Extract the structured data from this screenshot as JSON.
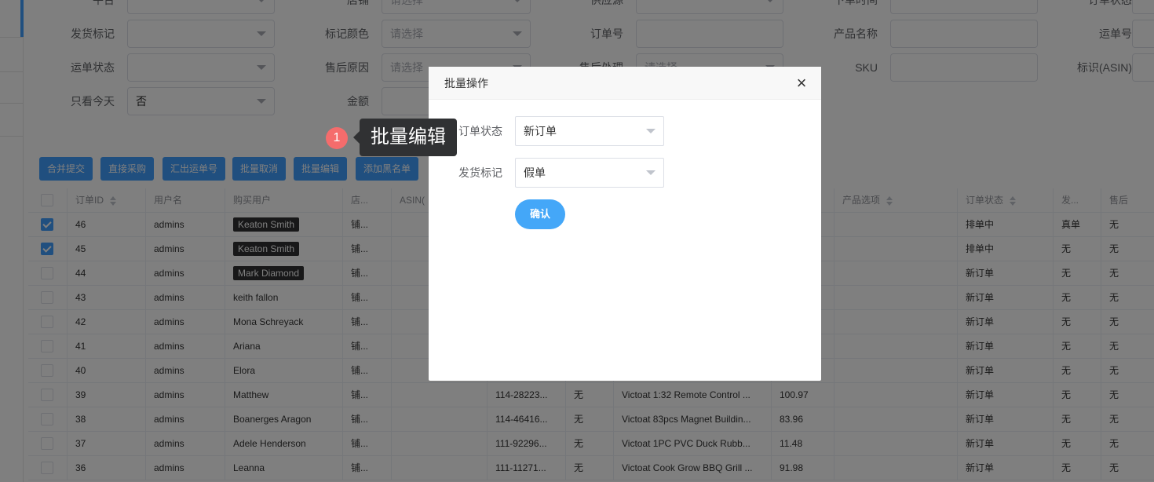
{
  "filters": {
    "row0": [
      {
        "label": "平台",
        "placeholder": ""
      },
      {
        "label": "店铺",
        "placeholder": "请选择"
      },
      {
        "label": "供应源",
        "placeholder": ""
      },
      {
        "label": "下单时间",
        "placeholder": ""
      },
      {
        "label": "订单状态",
        "placeholder": ""
      }
    ],
    "row1": [
      {
        "label": "发货标记",
        "placeholder": ""
      },
      {
        "label": "标记颜色",
        "placeholder": "请选择"
      },
      {
        "label": "订单号",
        "placeholder": ""
      },
      {
        "label": "产品名称",
        "placeholder": ""
      },
      {
        "label": "运单号",
        "placeholder": ""
      }
    ],
    "row2": [
      {
        "label": "运单状态",
        "placeholder": ""
      },
      {
        "label": "售后原因",
        "placeholder": "请选择"
      },
      {
        "label": "售后处理",
        "placeholder": "请选择"
      },
      {
        "label": "SKU",
        "placeholder": ""
      },
      {
        "label": "标识(ASIN)",
        "placeholder": ""
      }
    ],
    "row3": [
      {
        "label": "只看今天",
        "value": "否"
      },
      {
        "label": "金额",
        "placeholder": ""
      }
    ]
  },
  "hint": {
    "number": "1",
    "text": "批量编辑"
  },
  "toolbar": {
    "buttons": [
      "合并提交",
      "直接采购",
      "汇出运单号",
      "批量取消",
      "批量编辑",
      "添加黑名单"
    ]
  },
  "table": {
    "headers": {
      "order_id": "订单ID",
      "username": "用户名",
      "buyer": "购买用户",
      "shop": "店...",
      "asin": "ASIN(",
      "amount": "",
      "options": "产品选项",
      "status": "订单状态",
      "ship": "发...",
      "after": "售后"
    },
    "rows": [
      {
        "id": "46",
        "user": "admins",
        "buyer": "Keaton Smith",
        "tagged": true,
        "checked": true,
        "shop": "铺...",
        "no": "",
        "flag": "",
        "product": "",
        "price": "",
        "status": "排单中",
        "ship": "真单",
        "after": "无"
      },
      {
        "id": "45",
        "user": "admins",
        "buyer": "Keaton Smith",
        "tagged": true,
        "checked": true,
        "shop": "铺...",
        "no": "",
        "flag": "",
        "product": "",
        "price": "",
        "status": "排单中",
        "ship": "无",
        "after": "无"
      },
      {
        "id": "44",
        "user": "admins",
        "buyer": "Mark Diamond",
        "tagged": true,
        "checked": false,
        "shop": "铺...",
        "no": "",
        "flag": "",
        "product": "",
        "price": "",
        "status": "新订单",
        "ship": "无",
        "after": "无"
      },
      {
        "id": "43",
        "user": "admins",
        "buyer": "keith fallon",
        "tagged": false,
        "checked": false,
        "shop": "铺...",
        "no": "",
        "flag": "",
        "product": "",
        "price": "",
        "status": "新订单",
        "ship": "无",
        "after": "无"
      },
      {
        "id": "42",
        "user": "admins",
        "buyer": "Mona Schreyack",
        "tagged": false,
        "checked": false,
        "shop": "铺...",
        "no": "",
        "flag": "",
        "product": "",
        "price": "",
        "status": "新订单",
        "ship": "无",
        "after": "无"
      },
      {
        "id": "41",
        "user": "admins",
        "buyer": "Ariana",
        "tagged": false,
        "checked": false,
        "shop": "铺...",
        "no": "",
        "flag": "",
        "product": "",
        "price": "",
        "status": "新订单",
        "ship": "无",
        "after": "无"
      },
      {
        "id": "40",
        "user": "admins",
        "buyer": "Elora",
        "tagged": false,
        "checked": false,
        "shop": "铺...",
        "no": "",
        "flag": "",
        "product": "",
        "price": "",
        "status": "新订单",
        "ship": "无",
        "after": "无"
      },
      {
        "id": "39",
        "user": "admins",
        "buyer": "Matthew",
        "tagged": false,
        "checked": false,
        "shop": "铺...",
        "no": "114-28223...",
        "flag": "无",
        "product": "Victoat 1:32 Remote Control ...",
        "price": "100.97",
        "status": "新订单",
        "ship": "无",
        "after": "无"
      },
      {
        "id": "38",
        "user": "admins",
        "buyer": "Boanerges Aragon",
        "tagged": false,
        "checked": false,
        "shop": "铺...",
        "no": "114-46416...",
        "flag": "无",
        "product": "Victoat 83pcs Magnet Buildin...",
        "price": "83.96",
        "status": "新订单",
        "ship": "无",
        "after": "无"
      },
      {
        "id": "37",
        "user": "admins",
        "buyer": "Adele Henderson",
        "tagged": false,
        "checked": false,
        "shop": "铺...",
        "no": "111-92296...",
        "flag": "无",
        "product": "Victoat 1PC PVC Duck Rubb...",
        "price": "11.48",
        "status": "新订单",
        "ship": "无",
        "after": "无"
      },
      {
        "id": "36",
        "user": "admins",
        "buyer": "Leanna",
        "tagged": false,
        "checked": false,
        "shop": "铺...",
        "no": "111-11271...",
        "flag": "无",
        "product": "Victoat Cook Grow BBQ Grill ...",
        "price": "91.98",
        "status": "新订单",
        "ship": "无",
        "after": "无"
      }
    ]
  },
  "modal": {
    "title": "批量操作",
    "close": "×",
    "fields": [
      {
        "label": "订单状态",
        "value": "新订单"
      },
      {
        "label": "发货标记",
        "value": "假单"
      }
    ],
    "confirm": "确认"
  }
}
